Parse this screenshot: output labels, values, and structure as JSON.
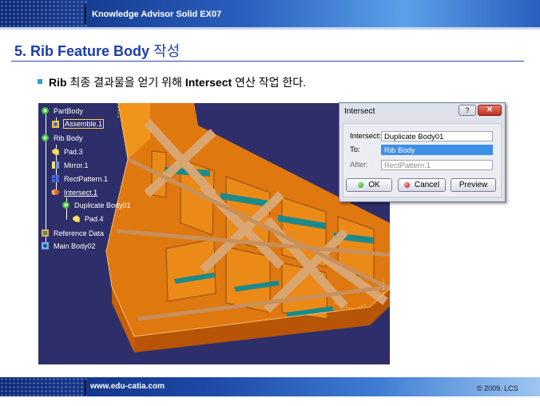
{
  "header": {
    "title": "Knowledge Advisor Solid EX07"
  },
  "slide": {
    "title_prefix": "5. Rib Feature Body",
    "title_suffix": " 작성",
    "bullet_bold_1": "Rib",
    "bullet_text_1": " 최종 결과물을 얻기 위해 ",
    "bullet_bold_2": "Intersect",
    "bullet_text_2": " 연산 작업 한다."
  },
  "tree": {
    "nodes": [
      {
        "label": "PartBody",
        "icon": "body-icon"
      },
      {
        "label": "Assemble.1",
        "icon": "assemble-icon"
      },
      {
        "label": "Rib Body",
        "icon": "body-icon"
      },
      {
        "label": "Pad.3",
        "icon": "pad-icon"
      },
      {
        "label": "Mirror.1",
        "icon": "mirror-icon"
      },
      {
        "label": "RectPattern.1",
        "icon": "pattern-icon"
      },
      {
        "label": "Intersect.1",
        "icon": "intersect-icon"
      },
      {
        "label": "Duplicate Body01",
        "icon": "body-icon"
      },
      {
        "label": "Pad.4",
        "icon": "pad-icon"
      },
      {
        "label": "Reference Data",
        "icon": "reference-icon"
      },
      {
        "label": "Main Body02",
        "icon": "body-icon"
      }
    ]
  },
  "dialog": {
    "title": "Intersect",
    "help_label": "?",
    "close_label": "✕",
    "intersect_label": "Intersect:",
    "intersect_value": "Duplicate Body01",
    "to_label": "To:",
    "to_value": "Rib Body",
    "after_label": "After:",
    "after_value": "RectPattern.1",
    "ok_label": "OK",
    "cancel_label": "Cancel",
    "preview_label": "Preview"
  },
  "footer": {
    "url": "www.edu-catia.com",
    "copyright": "© 2009. LCS"
  }
}
